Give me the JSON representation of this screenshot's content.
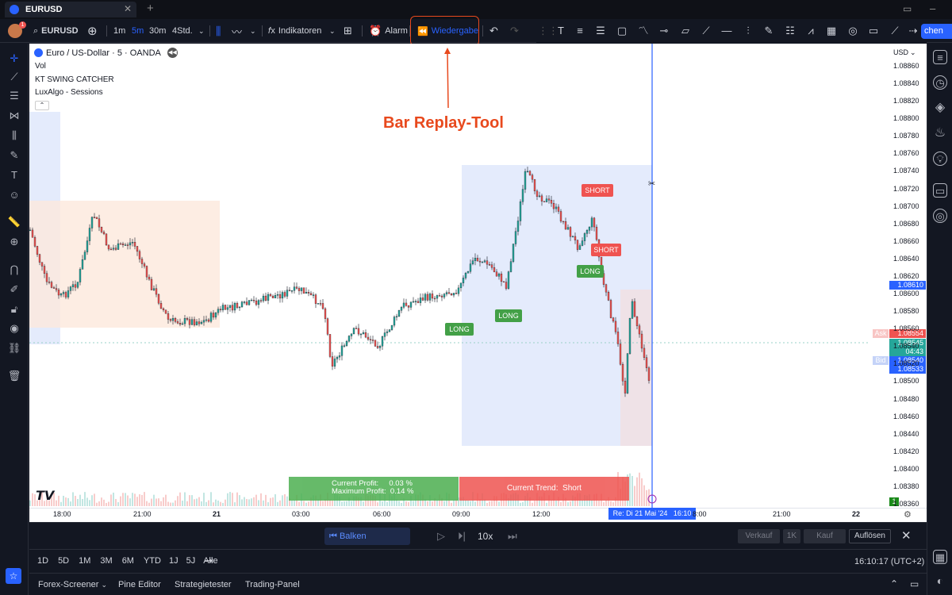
{
  "tab": {
    "title": "EURUSD"
  },
  "toolbar": {
    "symbol": "EURUSD",
    "intervals": [
      "1m",
      "5m",
      "30m",
      "4Std."
    ],
    "active_interval": "5m",
    "indicators": "Indikatoren",
    "alarm": "Alarm",
    "replay": "Wiedergabe",
    "publish_partial": "chen"
  },
  "chart": {
    "title": "Euro / US-Dollar · 5 · OANDA",
    "indicator_1": "Vol",
    "indicator_2": "KT SWING CATCHER",
    "indicator_3": "LuxAlgo - Sessions",
    "currency": "USD",
    "price_ticks": [
      "1.08860",
      "1.08840",
      "1.08820",
      "1.08800",
      "1.08780",
      "1.08760",
      "1.08740",
      "1.08720",
      "1.08700",
      "1.08680",
      "1.08660",
      "1.08640",
      "1.08620",
      "1.08600",
      "1.08580",
      "1.08560",
      "1.08540",
      "1.08520",
      "1.08500",
      "1.08480",
      "1.08460",
      "1.08440",
      "1.08420",
      "1.08400",
      "1.08380",
      "1.08360"
    ],
    "price_boxes": {
      "high_label": "1.08610",
      "ask_tag": "Ask",
      "ask": "1.08554",
      "last": "1.08545",
      "countdown": "04:43",
      "bid_tag": "Bid",
      "bid": "1.08540",
      "low_label": "1.08533"
    },
    "time_ticks": [
      "18:00",
      "21:00",
      "21",
      "03:00",
      "06:00",
      "09:00",
      "12:00",
      "8:00",
      "21:00",
      "22"
    ],
    "cursor_time": "Re: Di 21 Mai '24   16:10",
    "profit_line_1": "Current Profit:     0.03 %",
    "profit_line_2": "Maximum Profit:  0.14 %",
    "trend": "Current Trend:  Short",
    "signal_long": "LONG",
    "signal_short": "SHORT",
    "volume_badge": "1"
  },
  "annotation": {
    "text": "Bar Replay-Tool"
  },
  "replay_bar": {
    "select_bars": "Balken auswählen",
    "speed": "10x",
    "sell": "Verkauf",
    "qty": "1K",
    "buy": "Kauf",
    "dissolve": "Auflösen"
  },
  "range_bar": {
    "ranges": [
      "1D",
      "5D",
      "1M",
      "3M",
      "6M",
      "YTD",
      "1J",
      "5J",
      "Alle"
    ],
    "clock": "16:10:17 (UTC+2)"
  },
  "panel_tabs": [
    "Forex-Screener",
    "Pine Editor",
    "Strategietester",
    "Trading-Panel"
  ],
  "colors": {
    "accent": "#2962ff",
    "up": "#26a69a",
    "down": "#ef5350",
    "annotation": "#e8491d"
  }
}
